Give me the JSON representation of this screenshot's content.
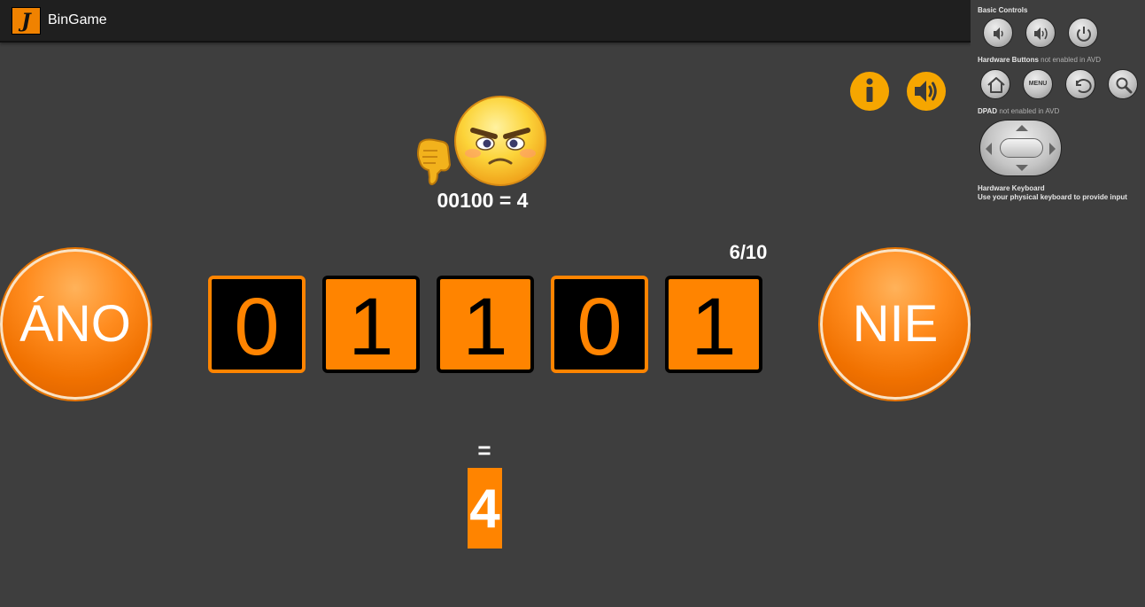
{
  "app": {
    "title": "BinGame",
    "logo_icon": "bingame-logo-icon",
    "logo_text": "J",
    "accent_color": "#ff8400",
    "background_color": "#3e3e3e"
  },
  "toolbar": {
    "info_icon": "info-icon",
    "sound_icon": "speaker-icon"
  },
  "feedback": {
    "face_icon": "angry-face-icon",
    "hand_icon": "thumbs-down-icon",
    "equation": "00100 = 4"
  },
  "game": {
    "progress": "6/10",
    "yes_label": "ÁNO",
    "no_label": "NIE",
    "bits": [
      {
        "value": "0",
        "style": "dark"
      },
      {
        "value": "1",
        "style": "orange"
      },
      {
        "value": "1",
        "style": "orange"
      },
      {
        "value": "0",
        "style": "dark"
      },
      {
        "value": "1",
        "style": "orange"
      }
    ],
    "equals": "=",
    "answer": "4"
  },
  "emulator": {
    "basic_controls_label": "Basic Controls",
    "hardware_buttons_label": "Hardware Buttons",
    "hardware_buttons_note": "not enabled in AVD",
    "dpad_label": "DPAD",
    "dpad_note": "not enabled in AVD",
    "keyboard_label": "Hardware Keyboard",
    "keyboard_note": "Use your physical keyboard to provide input",
    "basic_buttons": [
      "volume-down-icon",
      "volume-up-icon",
      "power-icon"
    ],
    "hardware_buttons": [
      "home-icon",
      "MENU",
      "back-icon",
      "search-icon"
    ]
  }
}
